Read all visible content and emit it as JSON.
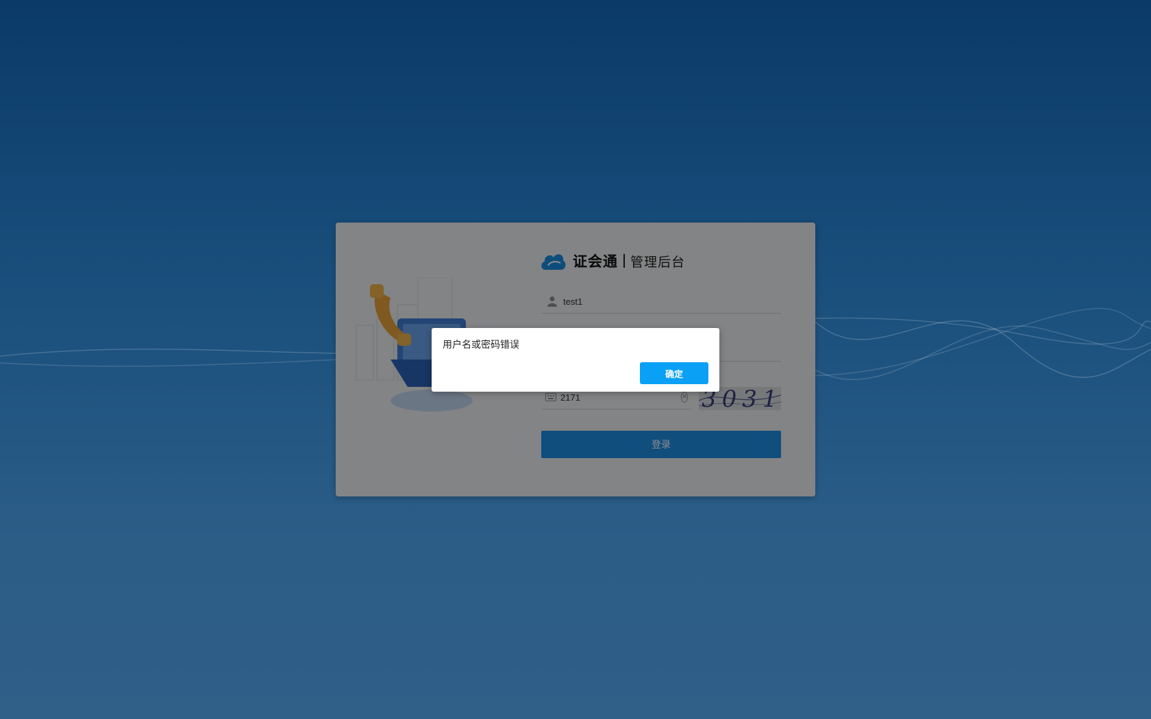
{
  "brand": {
    "name": "证会通",
    "subtitle": "管理后台"
  },
  "login": {
    "username_value": "test1",
    "password_value": "",
    "captcha_value": "2171",
    "captcha_image_text": "3031",
    "login_label": "登录"
  },
  "dialog": {
    "message": "用户名或密码错误",
    "ok_label": "确定"
  },
  "icons": {
    "logo": "cloud-icon",
    "username": "user-icon",
    "password": "lock-icon",
    "captcha": "keyboard-icon",
    "clear": "clear-icon",
    "illustration": "phone-computer-illustration"
  },
  "colors": {
    "background_top": "#0b3a68",
    "background_bottom": "#305f88",
    "primary_button": "#1e8fe6",
    "dialog_button": "#0aa0f5",
    "brand_accent": "#1a8de0"
  }
}
